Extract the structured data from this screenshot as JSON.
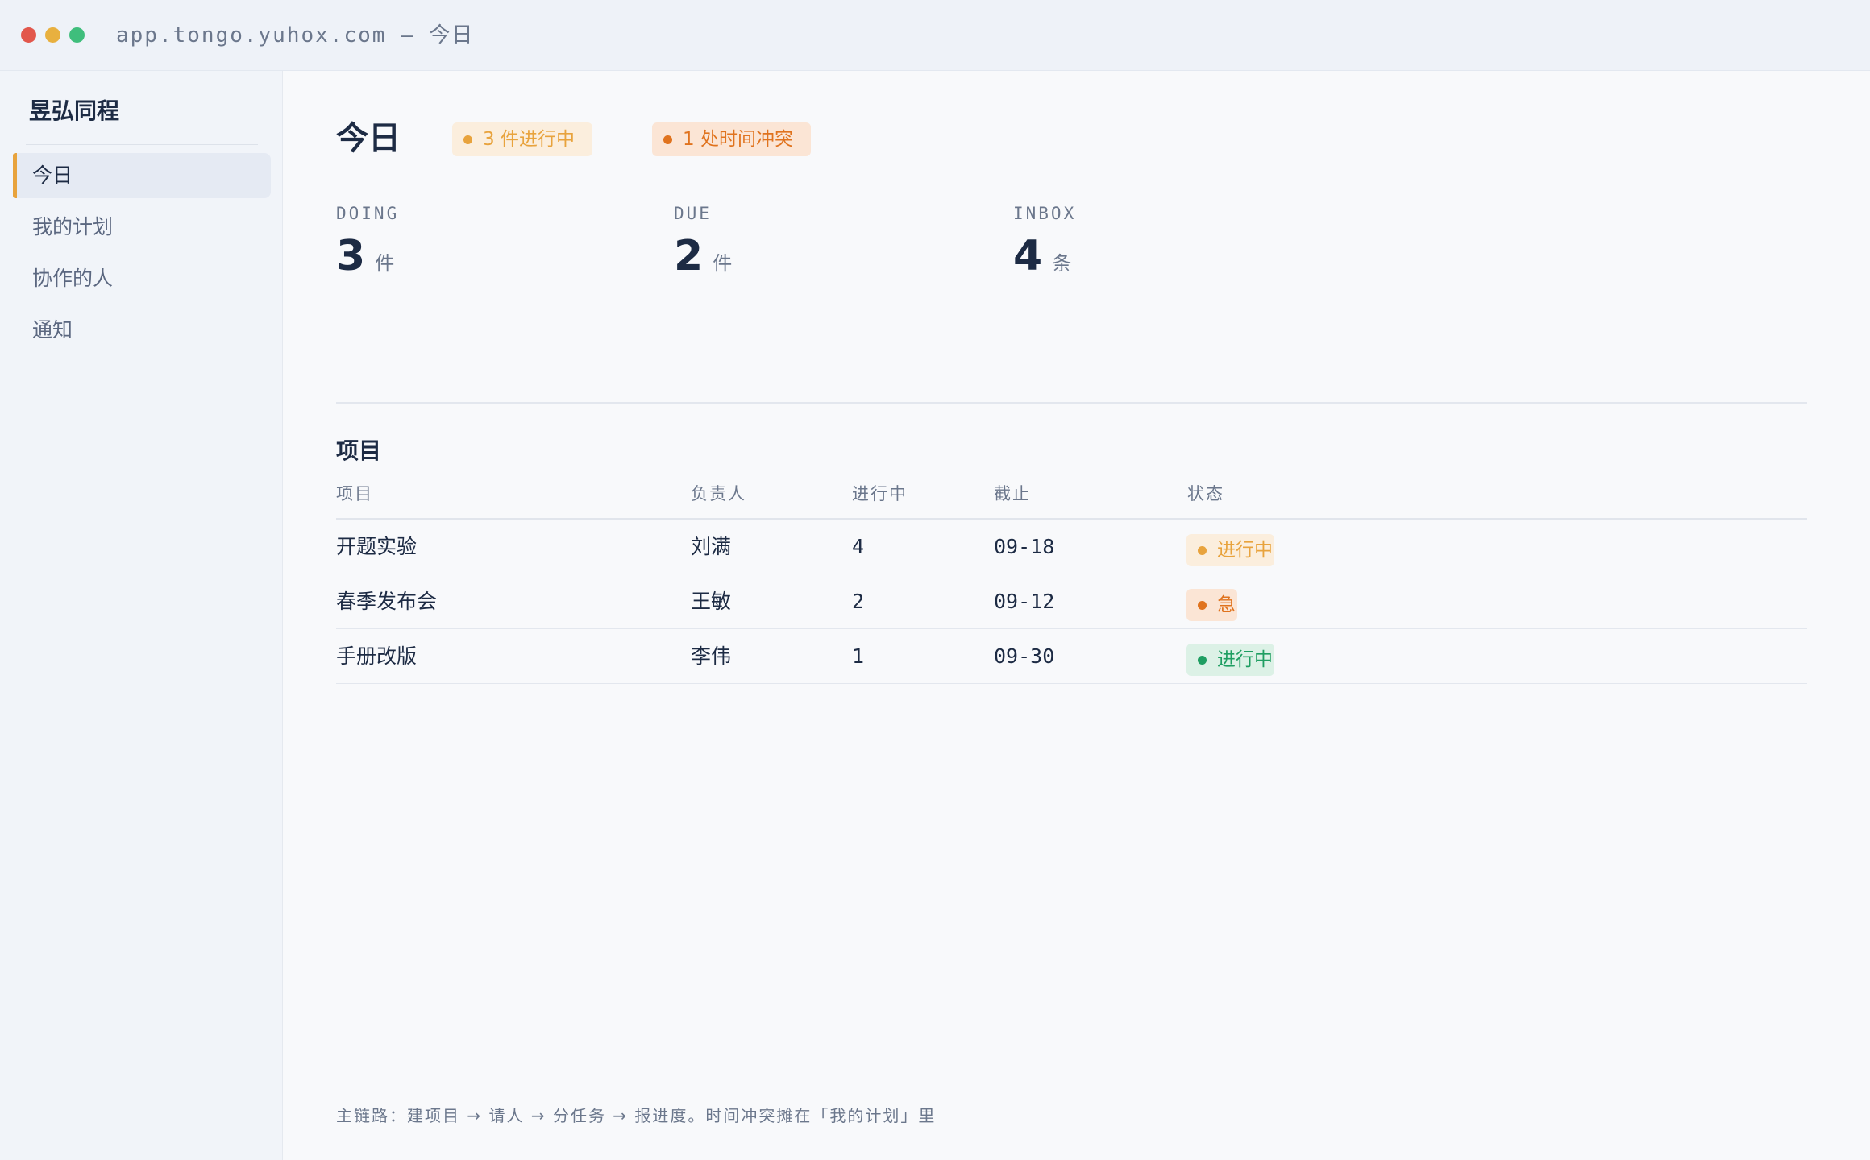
{
  "window": {
    "url_title": "app.tongo.yuhox.com — 今日"
  },
  "sidebar": {
    "brand": "昱弘同程",
    "items": [
      {
        "label": "今日",
        "active": true
      },
      {
        "label": "我的计划",
        "active": false
      },
      {
        "label": "协作的人",
        "active": false
      },
      {
        "label": "通知",
        "active": false
      }
    ]
  },
  "header": {
    "title": "今日",
    "badges": {
      "doing": "3 件进行中",
      "conflict": "1 处时间冲突"
    }
  },
  "stats": [
    {
      "label": "DOING",
      "value": "3",
      "unit": "件"
    },
    {
      "label": "DUE",
      "value": "2",
      "unit": "件"
    },
    {
      "label": "INBOX",
      "value": "4",
      "unit": "条"
    }
  ],
  "projects": {
    "title": "项目",
    "columns": [
      "项目",
      "负责人",
      "进行中",
      "截止",
      "状态"
    ],
    "rows": [
      {
        "name": "开题实验",
        "owner": "刘满",
        "doing": "4",
        "due": "09-18",
        "status": "进行中",
        "status_color": "#e8a33d",
        "status_bg": "#fbeedd"
      },
      {
        "name": "春季发布会",
        "owner": "王敏",
        "doing": "2",
        "due": "09-12",
        "status": "急",
        "status_color": "#e0731e",
        "status_bg": "#fbe5d5"
      },
      {
        "name": "手册改版",
        "owner": "李伟",
        "doing": "1",
        "due": "09-30",
        "status": "进行中",
        "status_color": "#1f9e62",
        "status_bg": "#dcf1e6"
      }
    ]
  },
  "footer": {
    "note": "主链路：建项目 → 请人 → 分任务 → 报进度。时间冲突摊在「我的计划」里"
  },
  "colors": {
    "accent": "#e8a33d",
    "conflict": "#e0731e",
    "ok": "#1f9e62"
  }
}
